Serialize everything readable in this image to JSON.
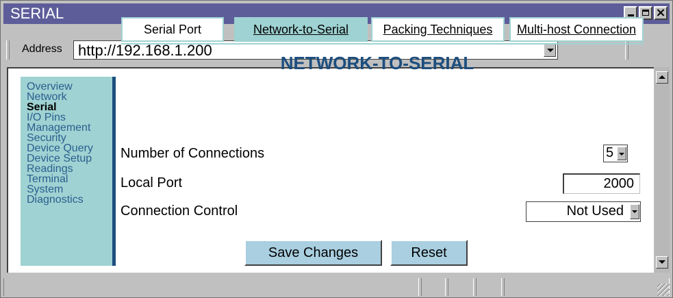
{
  "window": {
    "title": "SERIAL"
  },
  "address_bar": {
    "label": "Address",
    "url": "http://192.168.1.200"
  },
  "sidebar": {
    "items": [
      {
        "label": "Overview",
        "active": false
      },
      {
        "label": "Network",
        "active": false
      },
      {
        "label": "Serial",
        "active": true
      },
      {
        "label": "I/O Pins",
        "active": false
      },
      {
        "label": "Management",
        "active": false
      },
      {
        "label": "Security",
        "active": false
      },
      {
        "label": "Device Query",
        "active": false
      },
      {
        "label": "Device Setup",
        "active": false
      },
      {
        "label": "Readings",
        "active": false
      },
      {
        "label": "Terminal",
        "active": false
      },
      {
        "label": "System",
        "active": false
      },
      {
        "label": "Diagnostics",
        "active": false
      }
    ]
  },
  "tabs": [
    {
      "label": "Serial Port",
      "active": false
    },
    {
      "label": "Network-to-Serial",
      "active": true
    },
    {
      "label": "Packing Techniques",
      "active": false
    },
    {
      "label": "Multi-host Connection",
      "active": false
    }
  ],
  "page": {
    "heading": "NETWORK-TO-SERIAL"
  },
  "form": {
    "connections_label": "Number of Connections",
    "connections_value": "5",
    "local_port_label": "Local Port",
    "local_port_value": "2000",
    "connection_control_label": "Connection Control",
    "connection_control_value": "Not Used"
  },
  "buttons": {
    "save": "Save Changes",
    "reset": "Reset"
  },
  "colors": {
    "titlebar": "#5d5d9a",
    "accent_teal": "#9fd2d2",
    "heading_blue": "#1c4e7e",
    "button_blue": "#a9cfe0"
  }
}
